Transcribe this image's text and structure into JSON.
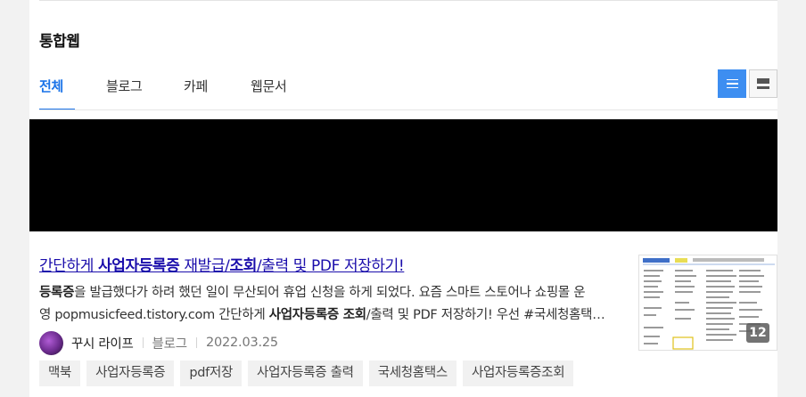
{
  "section": {
    "title": "통합웹"
  },
  "tabs": [
    {
      "label": "전체",
      "active": true
    },
    {
      "label": "블로그",
      "active": false
    },
    {
      "label": "카페",
      "active": false
    },
    {
      "label": "웹문서",
      "active": false
    }
  ],
  "view_toggle": {
    "active": "list",
    "options": [
      "list-icon",
      "tile-icon"
    ]
  },
  "result": {
    "title_pre": "간단하게 ",
    "title_bold": "사업자등록증",
    "title_mid": " 재발급/",
    "title_bold2": "조회",
    "title_post": "/출력 및 PDF 저장하기!",
    "snippet_bold1": "등록증",
    "snippet_line1_rest": "을 발급했다가 하려 했던 일이 무산되어 휴업 신청을 하게 되었다. 요즘 스마트 스토어나 쇼핑몰 운",
    "snippet_line2_pre": "영 popmusicfeed.tistory.com 간단하게 ",
    "snippet_bold2": "사업자등록증 조회",
    "snippet_line2_post": "/출력 및 PDF 저장하기! 우선 #국세청홈택스 ...",
    "author": "꾸시 라이프",
    "type": "블로그",
    "date": "2022.03.25",
    "thumb_count": "12"
  },
  "tags": [
    "맥북",
    "사업자등록증",
    "pdf저장",
    "사업자등록증 출력",
    "국세청홈택스",
    "사업자등록증조회"
  ],
  "colors": {
    "accent": "#1a73e8",
    "link": "#1a0dab",
    "toggle_active": "#3d8ef1"
  }
}
